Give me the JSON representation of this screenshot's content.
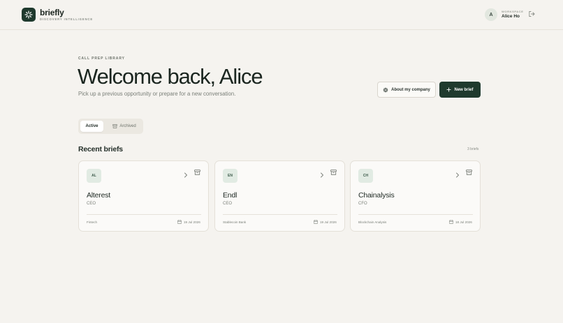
{
  "brand": {
    "name": "briefly",
    "tagline": "DISCOVERY INTELLIGENCE"
  },
  "user": {
    "workspace_label": "WORKSPACE",
    "name": "Alice Ho",
    "initial": "A"
  },
  "header": {
    "eyebrow": "CALL PREP LIBRARY",
    "title": "Welcome back, Alice",
    "subtitle": "Pick up a previous opportunity or prepare for a new conversation."
  },
  "actions": {
    "about_label": "About my company",
    "new_label": "New brief"
  },
  "tabs": [
    {
      "label": "Active"
    },
    {
      "label": "Archived"
    }
  ],
  "section": {
    "title": "Recent briefs",
    "count": "3 briefs"
  },
  "briefs": [
    {
      "initials": "AL",
      "name": "Alterest",
      "role": "CEO",
      "industry": "Fintech",
      "date": "19 Jul 2026"
    },
    {
      "initials": "EN",
      "name": "Endl",
      "role": "CEO",
      "industry": "Stablecoin Bank",
      "date": "19 Jul 2026"
    },
    {
      "initials": "CH",
      "name": "Chainalysis",
      "role": "CFO",
      "industry": "Blockchain Analysis",
      "date": "18 Jul 2026"
    }
  ],
  "colors": {
    "accent": "#1f3a2e",
    "background": "#f5f3ef",
    "badge": "#e1ebe3"
  }
}
